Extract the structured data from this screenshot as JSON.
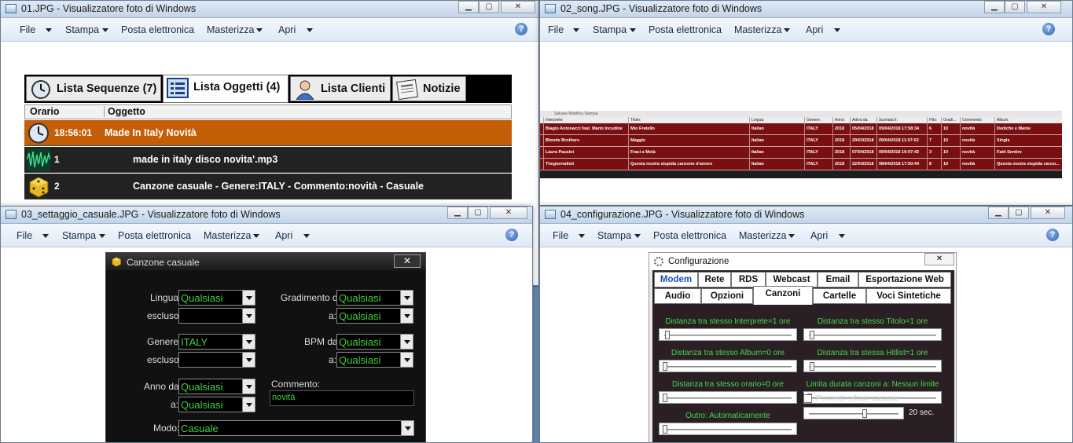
{
  "toolbar": {
    "file": "File",
    "stampa": "Stampa",
    "posta": "Posta elettronica",
    "masterizza": "Masterizza",
    "apri": "Apri",
    "help": "?"
  },
  "win1": {
    "title": "01.JPG - Visualizzatore foto di Windows",
    "tabs": [
      "Lista Sequenze (7)",
      "Lista Oggetti (4)",
      "Lista Clienti",
      "Notizie"
    ],
    "headers": [
      "Orario",
      "Oggetto"
    ],
    "rows": [
      {
        "time": "18:56:01",
        "object": "Made In Italy Novità"
      },
      {
        "time": "1",
        "object": "made in italy disco novita'.mp3"
      },
      {
        "time": "2",
        "object": "Canzone casuale - Genere:ITALY - Commento:novità - Casuale"
      }
    ]
  },
  "win2": {
    "title": "02_song.JPG - Visualizzatore foto di Windows",
    "menu": "Salvare   Modifica   Stampa",
    "headers": [
      "Interprete:",
      "Titolo:",
      "Lingua:",
      "Genere:",
      "Anno:",
      "Attiva da:",
      "Suonata il:",
      "Hits:",
      "Gradi...",
      "Commento:",
      "Album:"
    ],
    "rows": [
      [
        "Biagio Antonacci feat. Mario Incudine",
        "Mio Fratello",
        "Italian",
        "ITALY",
        "2018",
        "05/04/2018",
        "09/04/2018 17:58:34",
        "6",
        "10",
        "novità",
        "Dediche e Manie"
      ],
      [
        "Blonde Brothers",
        "Maggie",
        "Italian",
        "ITALY",
        "2018",
        "29/03/2018",
        "09/04/2018 11:57:02",
        "7",
        "10",
        "novità",
        "Single"
      ],
      [
        "Laura Pausini",
        "Frasi a Metà",
        "Italian",
        "ITALY",
        "2018",
        "07/04/2018",
        "09/04/2018 10:07:42",
        "3",
        "10",
        "novità",
        "Fatti Sentire"
      ],
      [
        "Thegiornalisti",
        "Questa nostra stupida canzone d'amore",
        "Italian",
        "ITALY",
        "2018",
        "22/03/2018",
        "08/04/2018 17:50:44",
        "8",
        "10",
        "novità",
        "Questa nostra stupida canzo..."
      ]
    ]
  },
  "win3": {
    "title": "03_settaggio_casuale.JPG - Visualizzatore foto di Windows",
    "dialog_title": "Canzone casuale",
    "close": "✕",
    "fields": {
      "lingua_lbl": "Lingua:",
      "lingua": "Qualsiasi",
      "lingua_escl_lbl": "escluso:",
      "lingua_escl": "",
      "gradimento_lbl": "Gradimento da:",
      "gradimento": "Qualsiasi",
      "gradimento_a_lbl": "a:",
      "gradimento_a": "Qualsiasi",
      "genere_lbl": "Genere:",
      "genere": "ITALY",
      "genere_escl_lbl": "escluso:",
      "genere_escl": "",
      "bpm_lbl": "BPM da:",
      "bpm": "Qualsiasi",
      "bpm_a_lbl": "a:",
      "bpm_a": "Qualsiasi",
      "anno_lbl": "Anno da:",
      "anno": "Qualsiasi",
      "anno_a_lbl": "a:",
      "anno_a": "Qualsiasi",
      "commento_lbl": "Commento:",
      "commento": "novità",
      "modo_lbl": "Modo:",
      "modo": "Casuale"
    }
  },
  "win4": {
    "title": "04_configurazione.JPG - Visualizzatore foto di Windows",
    "dialog_title": "Configurazione",
    "tabs_row1": [
      "Modem",
      "Rete",
      "RDS",
      "Webcast",
      "Email",
      "Esportazione Web"
    ],
    "tabs_row2": [
      "Audio",
      "Opzioni",
      "Canzoni",
      "Cartelle",
      "Voci Sintetiche"
    ],
    "sliders": [
      {
        "label": "Distanza tra stesso Interprete=1 ore",
        "value": 0.02
      },
      {
        "label": "Distanza tra stesso Titolo=1 ore",
        "value": 0.02
      },
      {
        "label": "Distanza tra stesso Album=0 ore",
        "value": 0.0
      },
      {
        "label": "Distanza tra stessa Hitlist=1 ore",
        "value": 0.02
      },
      {
        "label": "Distanza tra stesso orario=0 ore",
        "value": 0.0
      },
      {
        "label": "Limita durata canzoni a: Nessun limite",
        "value": 0.0
      },
      {
        "label": "Outro: Automaticamente",
        "value": 0.0
      }
    ],
    "refrain_label": "Permetti refrain casuale",
    "refrain_value": "20 sec."
  }
}
